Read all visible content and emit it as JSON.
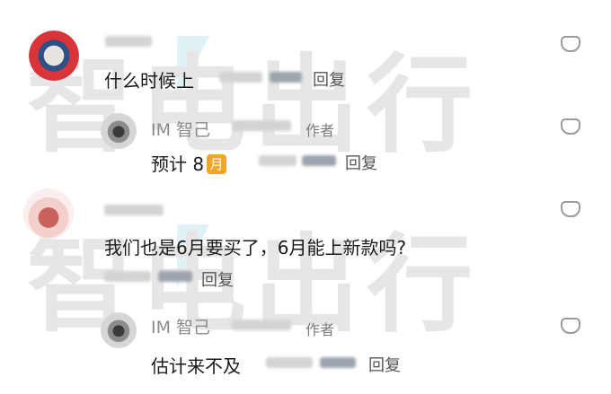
{
  "comments": [
    {
      "text": "什么时候上",
      "reply_label": "回复",
      "author_reply": {
        "name": "IM 智己",
        "badge": "作者",
        "text": "预计 8",
        "emoji": "月",
        "reply_label": "回复"
      }
    },
    {
      "text": "我们也是6月要买了，6月能上新款吗?",
      "reply_label": "回复",
      "author_reply": {
        "name": "IM 智己",
        "badge": "作者",
        "text": "估计来不及",
        "reply_label": "回复"
      }
    }
  ],
  "watermark": "智电出行",
  "icons": {
    "like": "heart-outline-icon",
    "emoji": "moon-month-emoji"
  },
  "colors": {
    "background": "#ffffff",
    "text": "#1a1a1a",
    "muted": "#8a8a8a",
    "emoji_bg": "#f5a524",
    "watermark": "#e6e6e6"
  }
}
